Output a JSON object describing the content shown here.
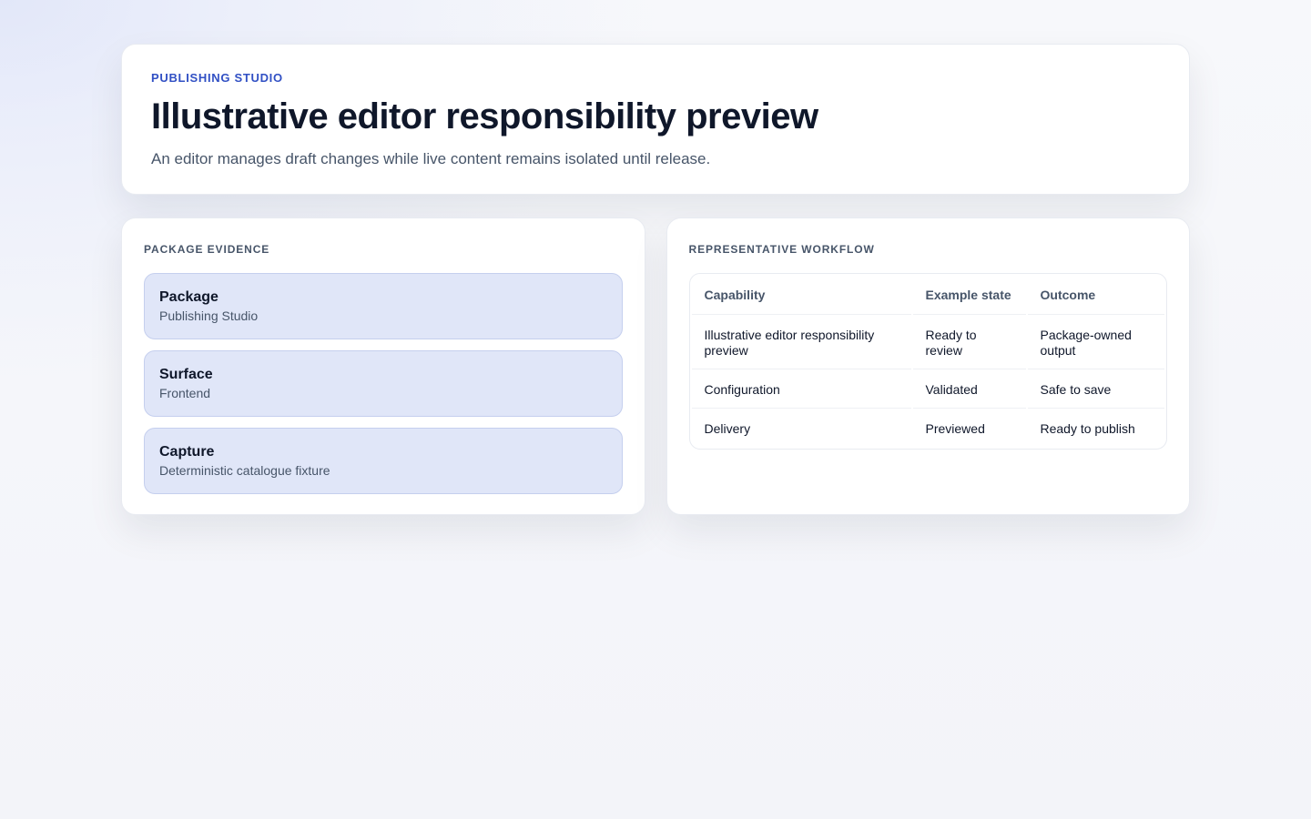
{
  "header": {
    "eyebrow": "PUBLISHING STUDIO",
    "title": "Illustrative editor responsibility preview",
    "subtitle": "An editor manages draft changes while live content remains isolated until release."
  },
  "evidence": {
    "title": "PACKAGE EVIDENCE",
    "items": [
      {
        "label": "Package",
        "value": "Publishing Studio"
      },
      {
        "label": "Surface",
        "value": "Frontend"
      },
      {
        "label": "Capture",
        "value": "Deterministic catalogue fixture"
      }
    ]
  },
  "workflow": {
    "title": "REPRESENTATIVE WORKFLOW",
    "columns": [
      "Capability",
      "Example state",
      "Outcome"
    ],
    "rows": [
      [
        "Illustrative editor responsibility preview",
        "Ready to review",
        "Package-owned output"
      ],
      [
        "Configuration",
        "Validated",
        "Safe to save"
      ],
      [
        "Delivery",
        "Previewed",
        "Ready to publish"
      ]
    ]
  }
}
